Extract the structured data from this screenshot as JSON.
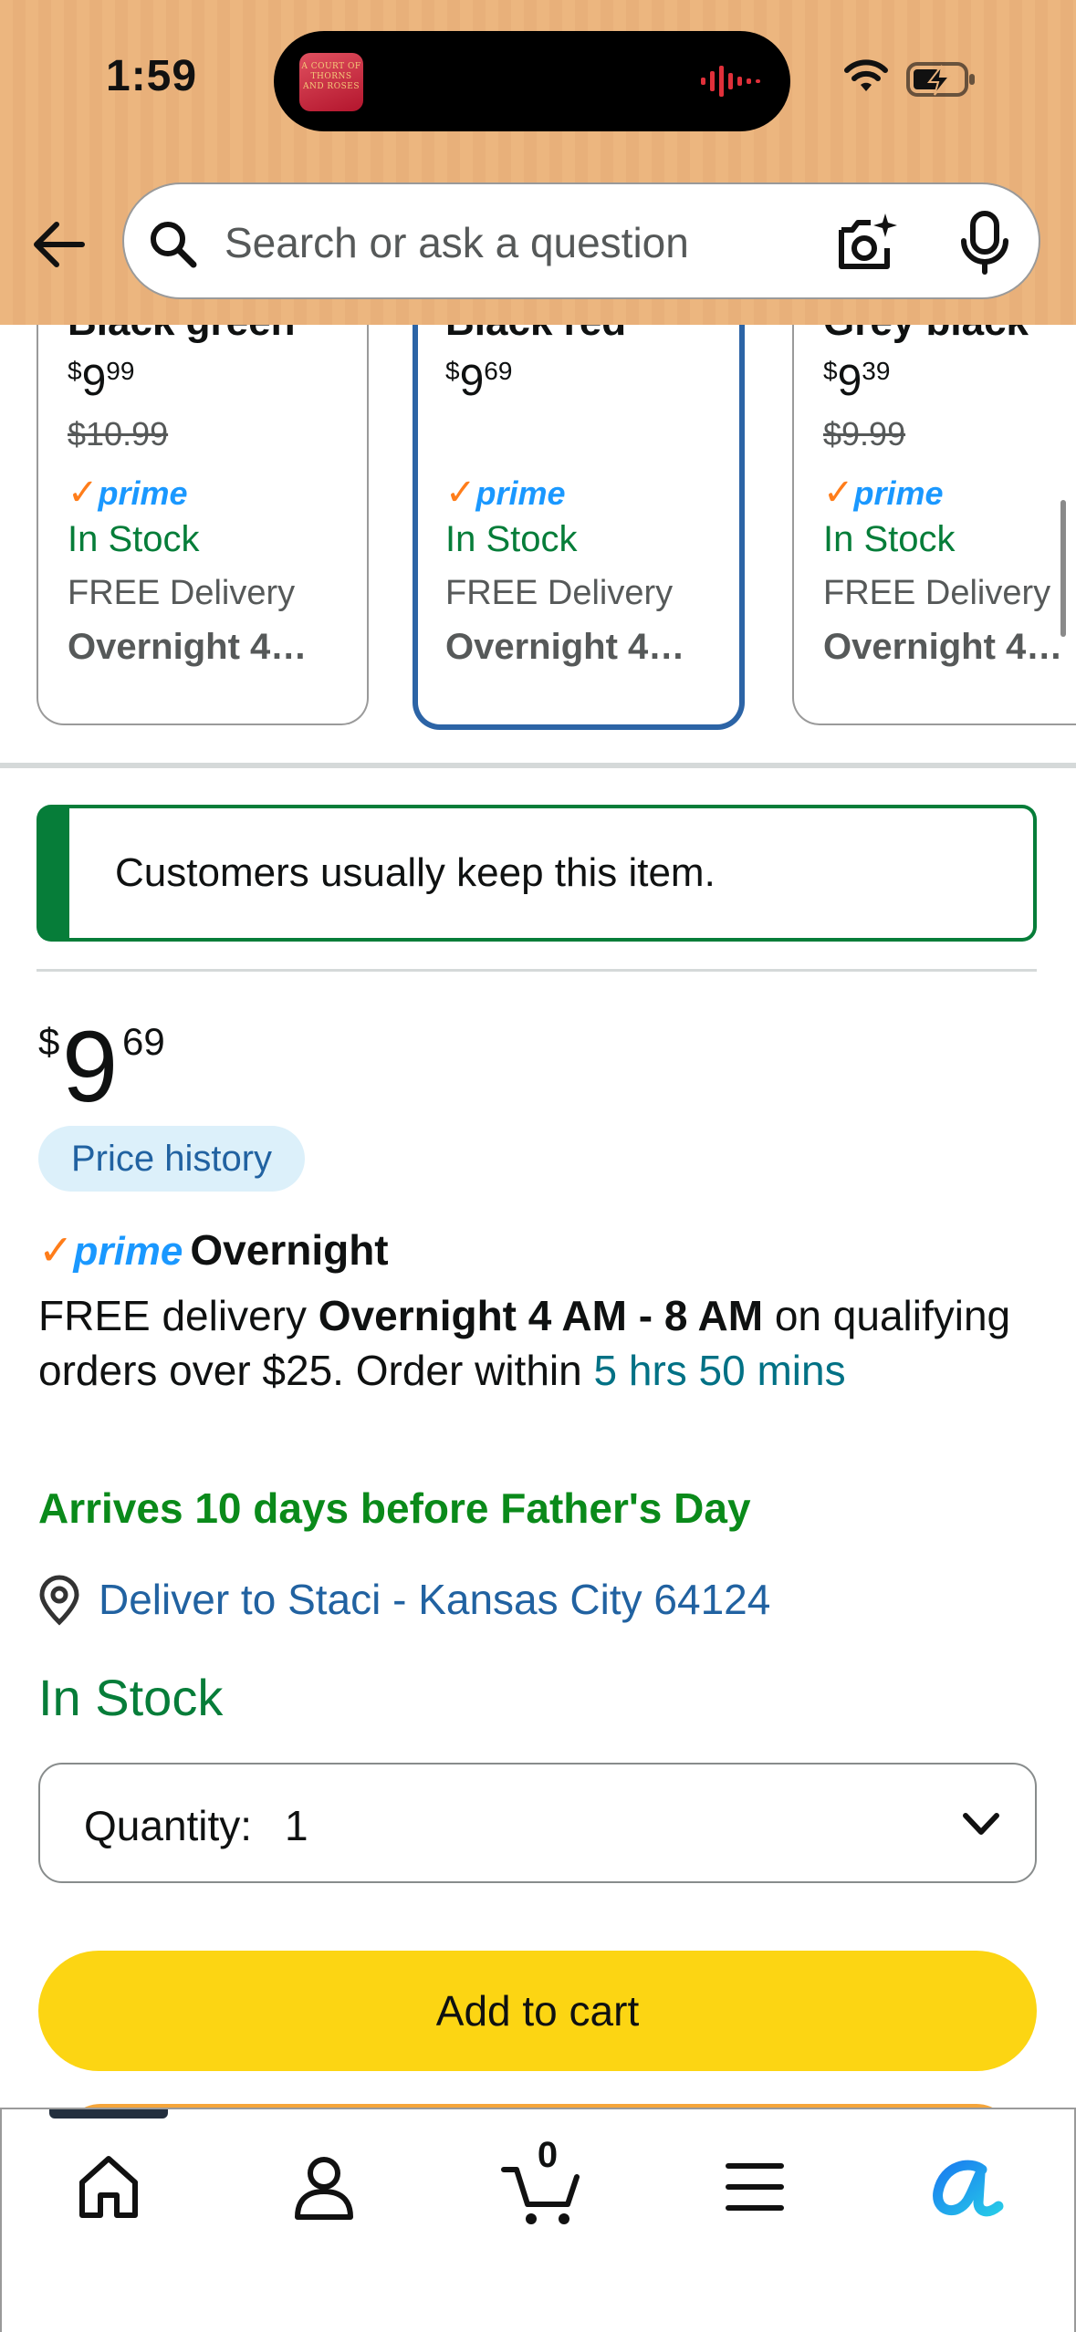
{
  "status_bar": {
    "time": "1:59",
    "now_playing_art_text": "A COURT OF THORNS AND ROSES"
  },
  "search": {
    "placeholder": "Search or ask a question"
  },
  "variants": [
    {
      "name": "Black green",
      "price_symbol": "$",
      "price_whole": "9",
      "price_fraction": "99",
      "list_price": "$10.99",
      "prime": "prime",
      "stock": "In Stock",
      "delivery": "FREE Delivery",
      "delivery_detail": "Overnight 4…",
      "selected": false
    },
    {
      "name": "Black red",
      "price_symbol": "$",
      "price_whole": "9",
      "price_fraction": "69",
      "list_price": "",
      "prime": "prime",
      "stock": "In Stock",
      "delivery": "FREE Delivery",
      "delivery_detail": "Overnight 4…",
      "selected": true
    },
    {
      "name": "Grey black",
      "price_symbol": "$",
      "price_whole": "9",
      "price_fraction": "39",
      "list_price": "$9.99",
      "prime": "prime",
      "stock": "In Stock",
      "delivery": "FREE Delivery",
      "delivery_detail": "Overnight 4…",
      "selected": false
    }
  ],
  "keep_banner": {
    "text": "Customers usually keep this item."
  },
  "price": {
    "symbol": "$",
    "whole": "9",
    "fraction": "69",
    "history_label": "Price history"
  },
  "prime_delivery": {
    "prime_word": "prime",
    "service": "Overnight",
    "line_prefix": "FREE delivery ",
    "window": "Overnight 4 AM - 8 AM",
    "line_middle": " on qualifying orders over $25. Order within ",
    "countdown": "5 hrs 50 mins"
  },
  "arrives": "Arrives 10 days before Father's Day",
  "deliver_to": "Deliver to Staci - Kansas City 64124",
  "availability": "In Stock",
  "quantity": {
    "label": "Quantity:",
    "value": "1"
  },
  "add_to_cart_label": "Add to cart",
  "bottom_nav": {
    "cart_count": "0",
    "items": [
      "home-icon",
      "account-icon",
      "cart-icon",
      "menu-icon",
      "rufus-icon"
    ]
  },
  "colors": {
    "header_bg": "#ecb67f",
    "prime_blue": "#1a98ff",
    "prime_check": "#ff7d1a",
    "in_stock_green": "#067d39",
    "link_blue": "#2162a1",
    "teal": "#007185",
    "add_to_cart_yellow": "#fcd513",
    "selected_border": "#2c64a6"
  }
}
